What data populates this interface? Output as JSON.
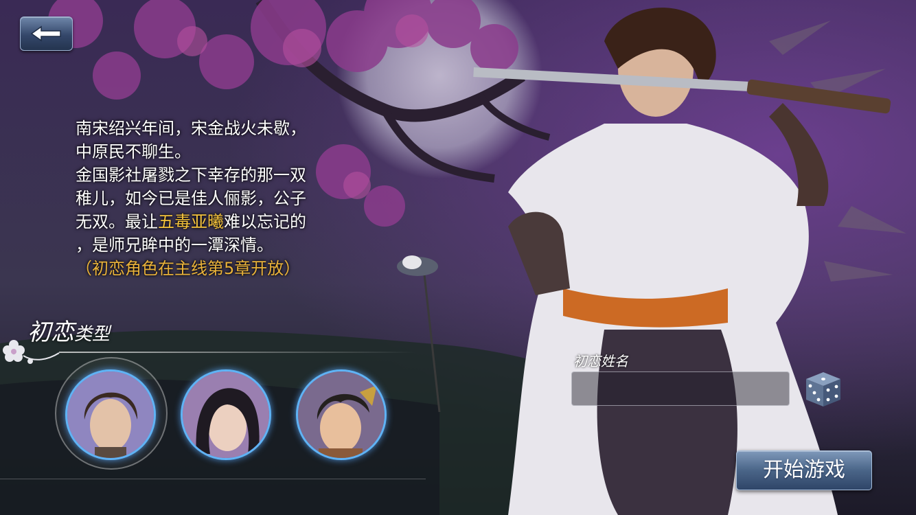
{
  "header": {
    "back_icon": "back-arrow-icon"
  },
  "story": {
    "lines": [
      "南宋绍兴年间，宋金战火未歇，",
      "中原民不聊生。",
      "金国影社屠戮之下幸存的那一双",
      "稚儿，如今已是佳人俪影，公子"
    ],
    "line5_pre": "无双。最让",
    "line5_highlight": "五毒亚曦",
    "line5_post": "难以忘记的",
    "line6": "，是师兄眸中的一潭深情。",
    "note": "（初恋角色在主线第5章开放）"
  },
  "type_section": {
    "title": "初恋",
    "title_sub": "类型"
  },
  "portraits": [
    {
      "name": "portrait-1",
      "selected": true
    },
    {
      "name": "portrait-2",
      "selected": false
    },
    {
      "name": "portrait-3",
      "selected": false
    }
  ],
  "name_section": {
    "label": "初恋姓名",
    "value": "",
    "placeholder": "",
    "dice_icon": "dice-icon"
  },
  "start_button": {
    "label": "开始游戏"
  },
  "colors": {
    "highlight": "#f6c43c",
    "note": "#e9b23a",
    "portrait_ring": "#5fb3f5",
    "button_blue": "#4a6588"
  }
}
